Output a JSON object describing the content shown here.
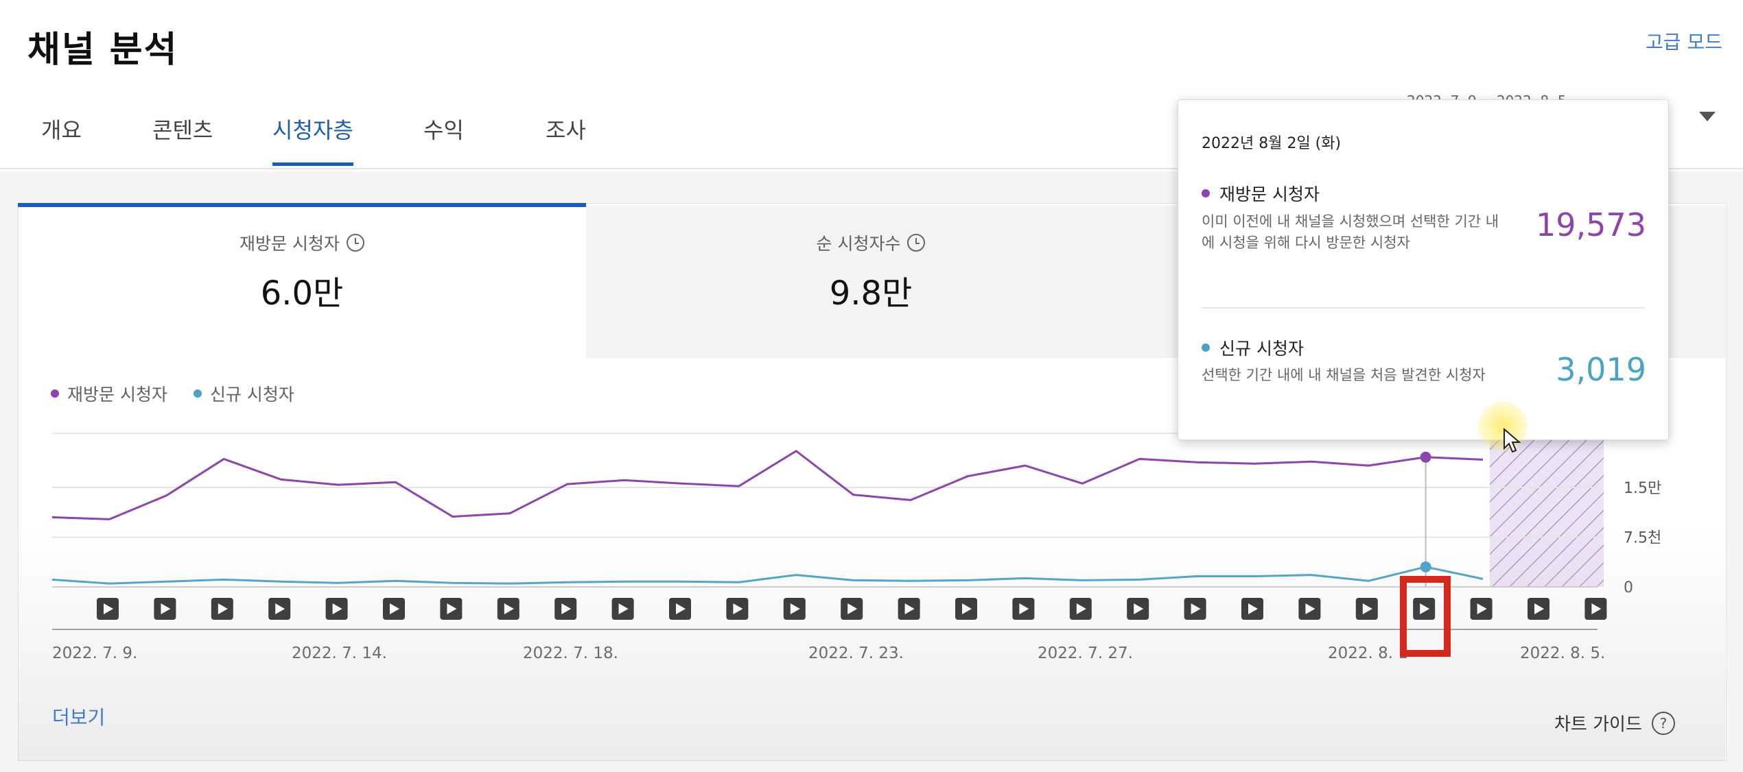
{
  "header": {
    "title": "채널 분석",
    "advanced_mode": "고급 모드"
  },
  "tabs": [
    {
      "label": "개요",
      "active": false
    },
    {
      "label": "콘텐츠",
      "active": false
    },
    {
      "label": "시청자층",
      "active": true
    },
    {
      "label": "수익",
      "active": false
    },
    {
      "label": "조사",
      "active": false
    }
  ],
  "date_range": "2022. 7. 9. – 2022. 8. 5.",
  "metrics": [
    {
      "label": "재방문 시청자",
      "value": "6.0만",
      "selected": true
    },
    {
      "label": "순 시청자수",
      "value": "9.8만",
      "selected": false
    }
  ],
  "legend": [
    {
      "name": "재방문 시청자",
      "color": "#8e44ad"
    },
    {
      "name": "신규 시청자",
      "color": "#4aa3c4"
    }
  ],
  "chart_data": {
    "type": "line",
    "x": [
      "2022. 7. 9.",
      "2022. 7. 10.",
      "2022. 7. 11.",
      "2022. 7. 12.",
      "2022. 7. 13.",
      "2022. 7. 14.",
      "2022. 7. 15.",
      "2022. 7. 16.",
      "2022. 7. 17.",
      "2022. 7. 18.",
      "2022. 7. 19.",
      "2022. 7. 20.",
      "2022. 7. 21.",
      "2022. 7. 22.",
      "2022. 7. 23.",
      "2022. 7. 24.",
      "2022. 7. 25.",
      "2022. 7. 26.",
      "2022. 7. 27.",
      "2022. 7. 28.",
      "2022. 7. 29.",
      "2022. 7. 30.",
      "2022. 7. 31.",
      "2022. 8. 1.",
      "2022. 8. 2.",
      "2022. 8. 3."
    ],
    "series": [
      {
        "name": "재방문 시청자",
        "color": "#8e44ad",
        "values": [
          10500,
          10200,
          13800,
          19300,
          16200,
          15400,
          15800,
          10600,
          11100,
          15500,
          16100,
          15600,
          15200,
          20500,
          13900,
          13100,
          16700,
          18300,
          15600,
          19300,
          18800,
          18600,
          18900,
          18300,
          19573,
          19200
        ]
      },
      {
        "name": "신규 시청자",
        "color": "#4aa3c4",
        "values": [
          1100,
          500,
          800,
          1100,
          800,
          600,
          900,
          600,
          500,
          700,
          800,
          800,
          700,
          1800,
          1000,
          900,
          1000,
          1300,
          1000,
          1100,
          1600,
          1600,
          1800,
          900,
          3019,
          1200
        ]
      }
    ],
    "x_tick_labels": [
      "2022. 7. 9.",
      "2022. 7. 14.",
      "2022. 7. 18.",
      "2022. 7. 23.",
      "2022. 7. 27.",
      "2022. 8. 1",
      "2022. 8. 5."
    ],
    "y_ticks": [
      {
        "value": 0,
        "label": "0"
      },
      {
        "value": 7500,
        "label": "7.5천"
      },
      {
        "value": 15000,
        "label": "1.5만"
      }
    ],
    "ylim": [
      0,
      24000
    ],
    "highlight_index": 24,
    "video_markers": 27
  },
  "tooltip": {
    "date": "2022년 8월 2일 (화)",
    "returning": {
      "title": "재방문 시청자",
      "desc": "이미 이전에 내 채널을 시청했으며 선택한 기간 내에 시청을 위해 다시 방문한 시청자",
      "value": "19,573",
      "color": "#8e44ad"
    },
    "new": {
      "title": "신규 시청자",
      "desc": "선택한 기간 내에 내 채널을 처음 발견한 시청자",
      "value": "3,019",
      "color": "#4aa3c4"
    }
  },
  "footer": {
    "more": "더보기",
    "chart_guide": "차트 가이드",
    "help_glyph": "?"
  }
}
